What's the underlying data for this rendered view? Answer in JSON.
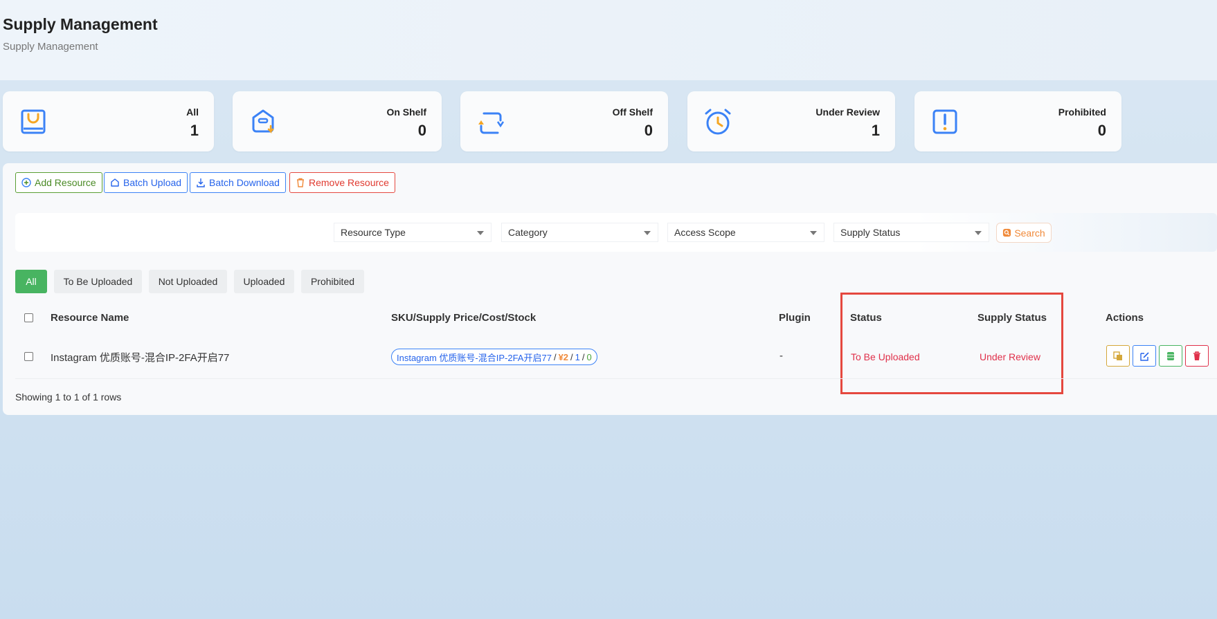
{
  "header": {
    "title": "Supply Management",
    "breadcrumb": "Supply Management"
  },
  "stats": [
    {
      "label": "All",
      "value": "1",
      "icon": "shopping-bag-icon"
    },
    {
      "label": "On Shelf",
      "value": "0",
      "icon": "box-upload-icon"
    },
    {
      "label": "Off Shelf",
      "value": "0",
      "icon": "refresh-arrows-icon"
    },
    {
      "label": "Under Review",
      "value": "1",
      "icon": "alarm-clock-icon"
    },
    {
      "label": "Prohibited",
      "value": "0",
      "icon": "alert-icon"
    }
  ],
  "toolbar": {
    "add": "Add Resource",
    "batch_upload": "Batch Upload",
    "batch_download": "Batch Download",
    "remove": "Remove Resource"
  },
  "filters": {
    "resource_type": "Resource Type",
    "category": "Category",
    "access_scope": "Access Scope",
    "supply_status": "Supply Status",
    "search": "Search"
  },
  "tabs": [
    "All",
    "To Be Uploaded",
    "Not Uploaded",
    "Uploaded",
    "Prohibited"
  ],
  "table": {
    "columns": {
      "name": "Resource Name",
      "sku": "SKU/Supply Price/Cost/Stock",
      "plugin": "Plugin",
      "status": "Status",
      "supply_status": "Supply Status",
      "actions": "Actions"
    },
    "rows": [
      {
        "name": "Instagram 优质账号-混合IP-2FA开启77",
        "sku_name": "Instagram 优质账号-混合IP-2FA开启77",
        "price": "¥2",
        "cost": "1",
        "stock": "0",
        "plugin": "-",
        "status": "To Be Uploaded",
        "supply_status": "Under Review"
      }
    ],
    "footer": "Showing 1 to 1 of 1 rows"
  },
  "colors": {
    "accent_blue": "#3b82f6",
    "accent_green": "#48b461",
    "danger_red": "#e5483f",
    "price_orange": "#f08a3a"
  }
}
